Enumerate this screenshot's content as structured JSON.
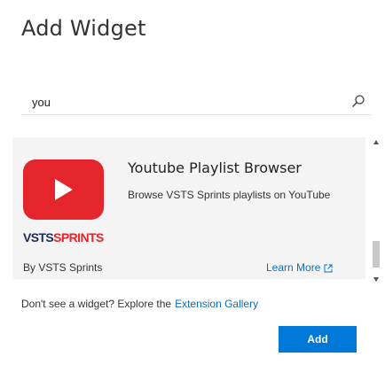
{
  "dialog": {
    "title": "Add Widget"
  },
  "search": {
    "value": "you",
    "icon": "search-icon"
  },
  "widgets": [
    {
      "name": "Youtube Playlist Browser",
      "description": "Browse VSTS Sprints playlists on YouTube",
      "brand_part1": "VSTS",
      "brand_part2": "SPRINTS",
      "publisher": "By VSTS Sprints",
      "learn_more_label": "Learn More",
      "learn_more_icon": "external-link-icon",
      "logo_color": "#e4252b",
      "brand_dark_color": "#1b2a5a"
    }
  ],
  "footer": {
    "prompt_text": "Don't see a widget? Explore the",
    "gallery_link_label": "Extension Gallery"
  },
  "actions": {
    "add_label": "Add"
  },
  "colors": {
    "accent": "#0078d7",
    "link": "#106ebe",
    "selected_item_bg": "#f4f4f4"
  }
}
